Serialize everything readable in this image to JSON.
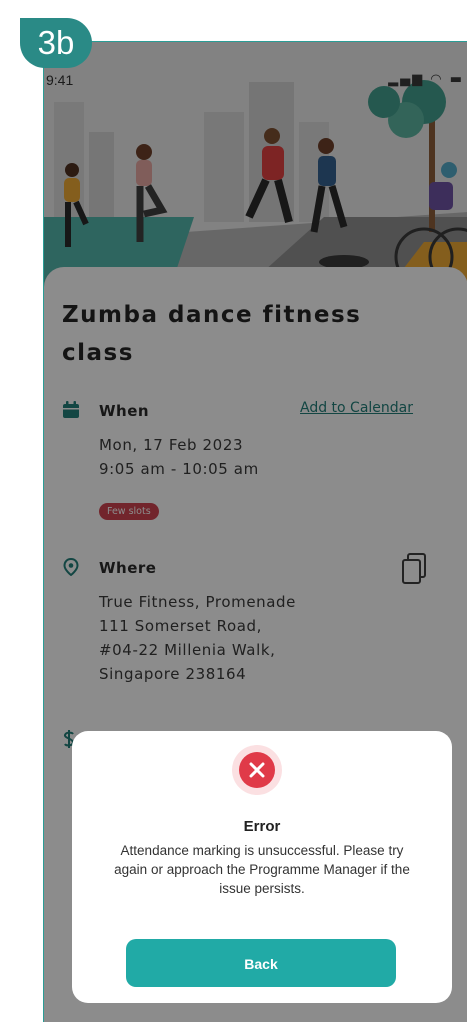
{
  "step_badge": "3b",
  "status_bar": {
    "time": "9:41",
    "icons": [
      "signal-icon",
      "wifi-icon",
      "battery-icon"
    ]
  },
  "event": {
    "title": "Zumba dance fitness class",
    "when": {
      "label": "When",
      "add_to_calendar": "Add to Calendar",
      "date": "Mon, 17 Feb 2023",
      "time": "9:05 am - 10:05 am",
      "slots_badge": "Few slots"
    },
    "where": {
      "label": "Where",
      "address_lines": [
        "True Fitness, Promenade",
        "111 Somerset Road,",
        "#04-22 Millenia Walk,",
        "Singapore 238164"
      ]
    }
  },
  "modal": {
    "title": "Error",
    "message": "Attendance marking is unsuccessful. Please try again or approach the Programme Manager if the issue persists.",
    "button": "Back"
  },
  "colors": {
    "accent": "#21aaa6",
    "brand_dark": "#1b7b76",
    "error": "#e03a48",
    "badge": "#2a8a86"
  }
}
